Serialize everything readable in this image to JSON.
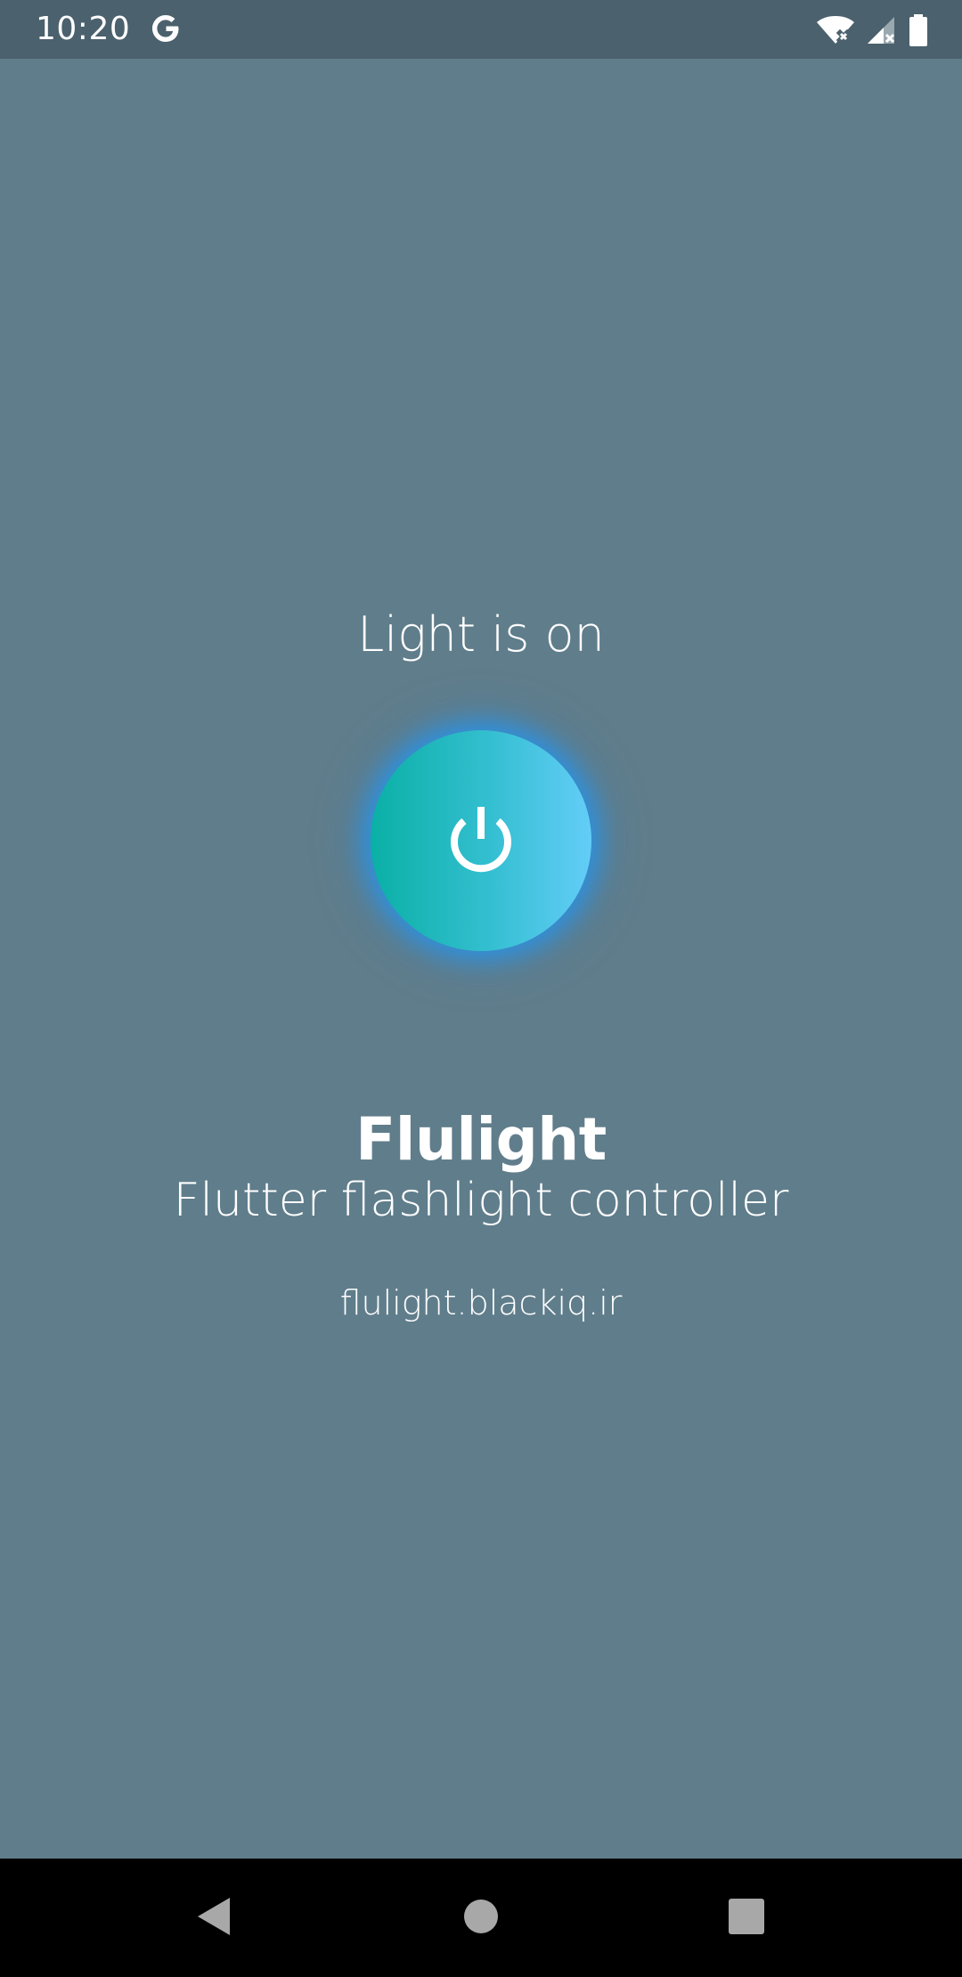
{
  "status_bar": {
    "time": "10:20",
    "icons": [
      "google-icon",
      "wifi-icon",
      "signal-icon",
      "battery-icon"
    ]
  },
  "main": {
    "light_status": "Light is on",
    "power_button": {
      "icon": "power-icon",
      "state": "on"
    },
    "app_title": "Flulight",
    "app_subtitle": "Flutter flashlight controller",
    "app_link": "flulight.blackiq.ir"
  },
  "nav_bar": {
    "buttons": [
      "back-icon",
      "home-icon",
      "recents-icon"
    ]
  },
  "colors": {
    "background": "#607d8b",
    "status_bar": "#4b616d",
    "button_gradient_start": "#0ab0a5",
    "button_gradient_end": "#63cdf8",
    "button_glow": "#2196f3",
    "nav_bar": "#000000",
    "text": "#ffffff"
  }
}
